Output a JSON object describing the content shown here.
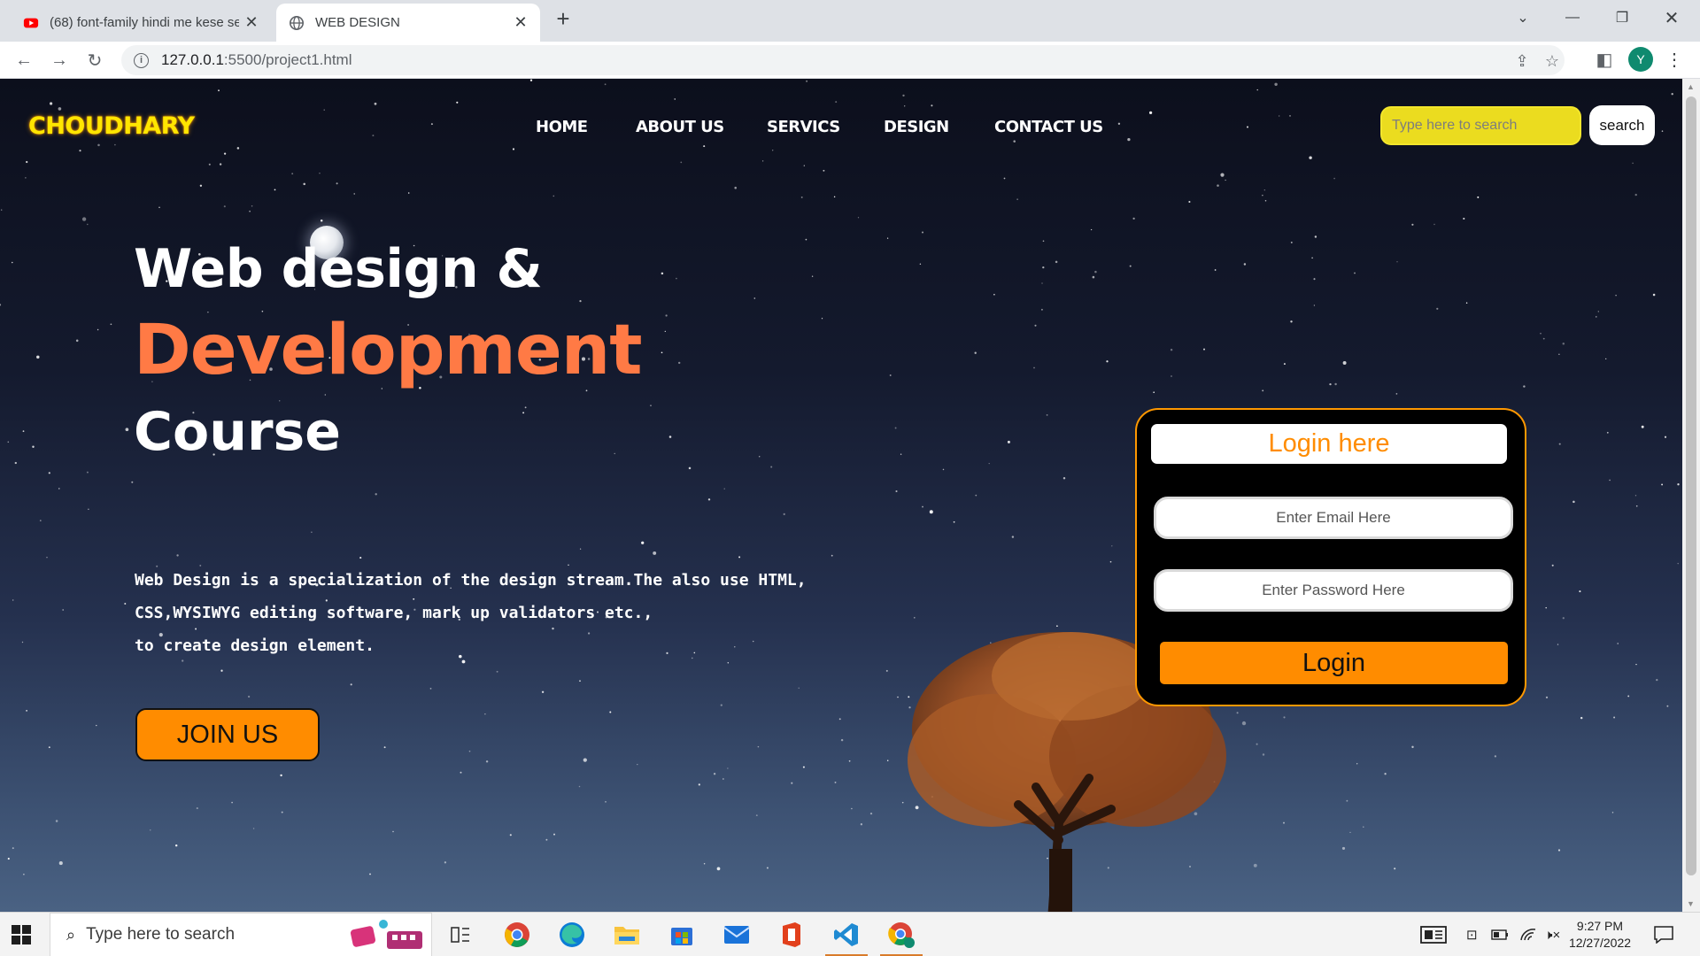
{
  "browser": {
    "tabs": [
      {
        "title": "(68) font-family hindi me kese se",
        "favicon": "youtube-icon",
        "active": false
      },
      {
        "title": "WEB DESIGN",
        "favicon": "globe-icon",
        "active": true
      }
    ],
    "address": {
      "host": "127.0.0.1",
      "path": ":5500/project1.html"
    },
    "profile_initial": "Y"
  },
  "page": {
    "brand": "CHOUDHARY",
    "nav": [
      "HOME",
      "ABOUT US",
      "SERVICS",
      "DESIGN",
      "CONTACT US"
    ],
    "search": {
      "placeholder": "Type here to search",
      "button": "search"
    },
    "hero": {
      "line1": "Web design &",
      "line2": "Development",
      "line3": "Course",
      "desc": [
        "Web Design is a specialization of the design stream.The also use HTML,",
        "CSS,WYSIWYG editing software, mark up validators etc.,",
        "to create design element."
      ],
      "cta": "JOIN US"
    },
    "login": {
      "title": "Login here",
      "email_placeholder": "Enter Email Here",
      "password_placeholder": "Enter Password Here",
      "button": "Login"
    },
    "colors": {
      "brand": "#ffe600",
      "accent": "#ff8c00",
      "heading_accent": "#ff7a45",
      "search_bg": "#ebdc1f"
    }
  },
  "taskbar": {
    "search_placeholder": "Type here to search",
    "apps": [
      "task-view-icon",
      "chrome-icon",
      "edge-icon",
      "file-explorer-icon",
      "microsoft-store-icon",
      "mail-icon",
      "office-icon",
      "vscode-icon",
      "chrome-profile-icon"
    ],
    "time": "9:27 PM",
    "date": "12/27/2022"
  }
}
